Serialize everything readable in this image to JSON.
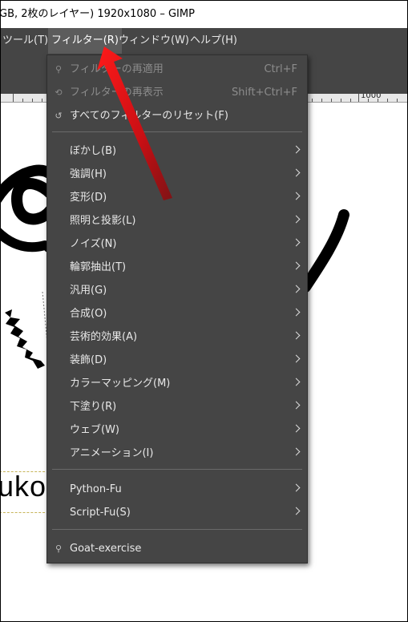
{
  "window": {
    "title": "GB, 2枚のレイヤー) 1920x1080 – GIMP"
  },
  "menubar": {
    "items": [
      {
        "label": "ツール(T)"
      },
      {
        "label": "フィルター(R)"
      },
      {
        "label": "ウィンドウ(W)"
      },
      {
        "label": "ヘルプ(H)"
      }
    ]
  },
  "ruler": {
    "label": "1000"
  },
  "canvas": {
    "text": "uko"
  },
  "filters_menu": {
    "reapply": {
      "label": "フィルターの再適用",
      "accel": "Ctrl+F"
    },
    "reshow": {
      "label": "フィルターの再表示",
      "accel": "Shift+Ctrl+F"
    },
    "reset_all": {
      "label": "すべてのフィルターのリセット(F)"
    },
    "submenus": [
      {
        "label": "ぼかし(B)"
      },
      {
        "label": "強調(H)"
      },
      {
        "label": "変形(D)"
      },
      {
        "label": "照明と投影(L)"
      },
      {
        "label": "ノイズ(N)"
      },
      {
        "label": "輪郭抽出(T)"
      },
      {
        "label": "汎用(G)"
      },
      {
        "label": "合成(O)"
      },
      {
        "label": "芸術的効果(A)"
      },
      {
        "label": "装飾(D)"
      },
      {
        "label": "カラーマッピング(M)"
      },
      {
        "label": "下塗り(R)"
      },
      {
        "label": "ウェブ(W)"
      },
      {
        "label": "アニメーション(I)"
      }
    ],
    "script_menus": [
      {
        "label": "Python-Fu"
      },
      {
        "label": "Script-Fu(S)"
      }
    ],
    "goat": {
      "label": "Goat-exercise"
    }
  },
  "colors": {
    "menu_bg": "#454545",
    "arrow_red": "#e0101a"
  }
}
